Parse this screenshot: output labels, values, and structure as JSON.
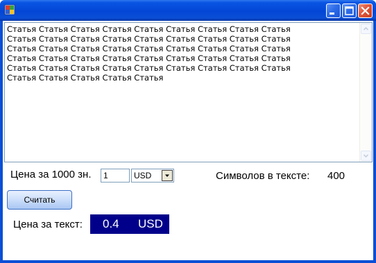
{
  "window": {
    "buttons": [
      "minimize",
      "maximize",
      "close"
    ]
  },
  "textbox": {
    "content": "Статья Статья Статья Статья Статья Статья Статья Статья Статья\nСтатья Статья Статья Статья Статья Статья Статья Статья Статья\nСтатья Статья Статья Статья Статья Статья Статья Статья Статья\nСтатья Статья Статья Статья Статья Статья Статья Статья Статья\nСтатья Статья Статья Статья Статья Статья Статья Статья Статья\nСтатья Статья Статья Статья Статья"
  },
  "form": {
    "price_label": "Цена за 1000 зн.",
    "price_value": "1",
    "currency": "USD",
    "chars_label": "Символов в тексте:",
    "chars_value": "400",
    "calc_button": "Считать",
    "total_label": "Цена за текст:",
    "total_value": "0.4",
    "total_currency": "USD"
  },
  "colors": {
    "title_bar": "#0a4fd6",
    "total_box": "#00008b",
    "close_button": "#e0553a"
  },
  "icons": [
    "app-icon",
    "minimize-icon",
    "maximize-icon",
    "close-icon",
    "scroll-up-icon",
    "scroll-down-icon",
    "dropdown-arrow-icon"
  ]
}
